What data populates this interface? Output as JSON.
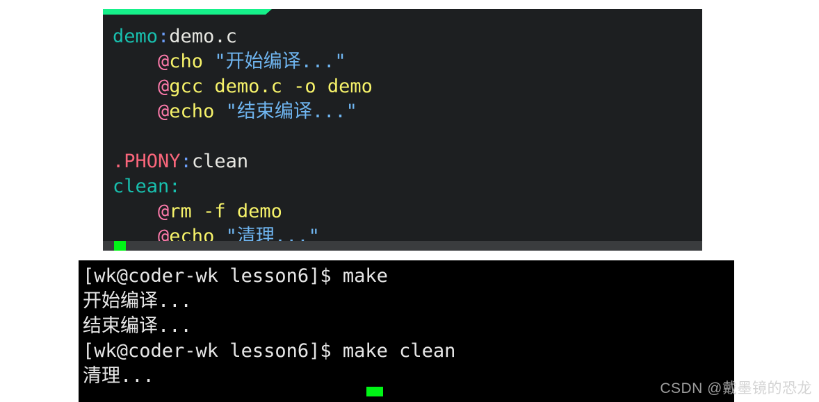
{
  "editor": {
    "name": "vim-editor",
    "tab_indicator_color": "#16f08a",
    "background": "#1d1f21",
    "cursor_color": "#00f516",
    "lines": [
      {
        "id": "line-target-demo",
        "tokens": [
          {
            "text": "demo",
            "cls": "tok-target"
          },
          {
            "text": ":",
            "cls": "tok-colon"
          },
          {
            "text": "demo.c",
            "cls": "tok-white"
          }
        ]
      },
      {
        "id": "line-echo-start",
        "tokens": [
          {
            "text": "    ",
            "cls": "tok-plain"
          },
          {
            "text": "@",
            "cls": "tok-at"
          },
          {
            "text": "cho ",
            "cls": "tok-cmd"
          },
          {
            "text": "\"开始编译...\"",
            "cls": "tok-str"
          }
        ]
      },
      {
        "id": "line-gcc",
        "tokens": [
          {
            "text": "    ",
            "cls": "tok-plain"
          },
          {
            "text": "@",
            "cls": "tok-at"
          },
          {
            "text": "gcc demo.c -o demo",
            "cls": "tok-cmd"
          }
        ]
      },
      {
        "id": "line-echo-end",
        "tokens": [
          {
            "text": "    ",
            "cls": "tok-plain"
          },
          {
            "text": "@",
            "cls": "tok-at"
          },
          {
            "text": "echo ",
            "cls": "tok-cmd"
          },
          {
            "text": "\"结束编译...\"",
            "cls": "tok-str"
          }
        ]
      },
      {
        "id": "line-blank",
        "tokens": [
          {
            "text": " ",
            "cls": "tok-plain"
          }
        ]
      },
      {
        "id": "line-phony",
        "tokens": [
          {
            "text": ".PHONY",
            "cls": "tok-phony"
          },
          {
            "text": ":",
            "cls": "tok-colon"
          },
          {
            "text": "clean",
            "cls": "tok-white"
          }
        ]
      },
      {
        "id": "line-target-clean",
        "tokens": [
          {
            "text": "clean",
            "cls": "tok-target"
          },
          {
            "text": ":",
            "cls": "tok-target"
          }
        ]
      },
      {
        "id": "line-rm",
        "tokens": [
          {
            "text": "    ",
            "cls": "tok-plain"
          },
          {
            "text": "@",
            "cls": "tok-at"
          },
          {
            "text": "rm -f demo",
            "cls": "tok-cmd"
          }
        ]
      },
      {
        "id": "line-echo-clean",
        "tokens": [
          {
            "text": "    ",
            "cls": "tok-plain"
          },
          {
            "text": "@",
            "cls": "tok-at"
          },
          {
            "text": "echo ",
            "cls": "tok-cmd"
          },
          {
            "text": "\"清理...\"",
            "cls": "tok-str"
          }
        ]
      }
    ]
  },
  "terminal": {
    "name": "shell-terminal",
    "background": "#000000",
    "foreground": "#e6e6e6",
    "cursor_color": "#00f516",
    "prompt": "[wk@coder-wk lesson6]$",
    "lines": [
      "[wk@coder-wk lesson6]$ make",
      "开始编译...",
      "结束编译...",
      "[wk@coder-wk lesson6]$ make clean",
      "清理..."
    ]
  },
  "watermark": {
    "text": "CSDN @戴墨镜的恐龙"
  }
}
